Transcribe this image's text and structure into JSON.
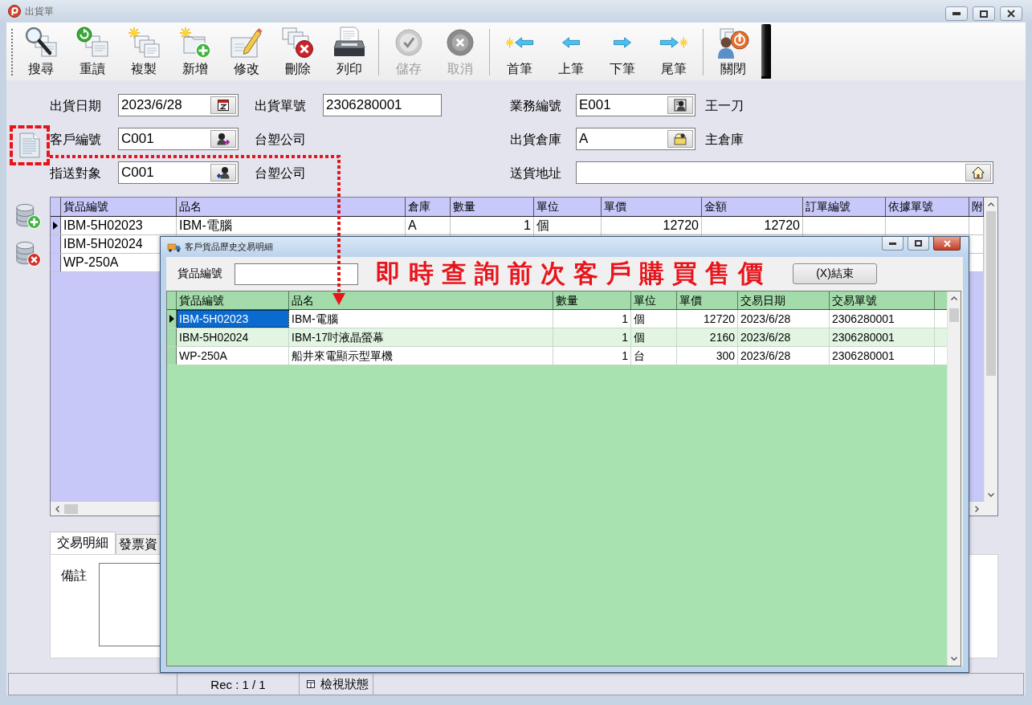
{
  "window": {
    "title": "出貨單"
  },
  "toolbar": [
    {
      "buttons": [
        {
          "label": "搜尋",
          "kind": "search",
          "disabled": false
        },
        {
          "label": "重讀",
          "kind": "reload",
          "disabled": false
        },
        {
          "label": "複製",
          "kind": "copy",
          "disabled": false
        },
        {
          "label": "新增",
          "kind": "add",
          "disabled": false
        },
        {
          "label": "修改",
          "kind": "edit",
          "disabled": false
        },
        {
          "label": "刪除",
          "kind": "delete",
          "disabled": false
        },
        {
          "label": "列印",
          "kind": "print",
          "disabled": false
        }
      ]
    },
    {
      "buttons": [
        {
          "label": "儲存",
          "kind": "save",
          "disabled": true
        },
        {
          "label": "取消",
          "kind": "cancel",
          "disabled": true
        }
      ]
    },
    {
      "buttons": [
        {
          "label": "首筆",
          "kind": "first",
          "disabled": false
        },
        {
          "label": "上筆",
          "kind": "prev",
          "disabled": false
        },
        {
          "label": "下筆",
          "kind": "next",
          "disabled": false
        },
        {
          "label": "尾筆",
          "kind": "last",
          "disabled": false
        }
      ]
    },
    {
      "buttons": [
        {
          "label": "關閉",
          "kind": "close",
          "disabled": false
        }
      ]
    }
  ],
  "form": {
    "left": [
      {
        "label": "出貨日期",
        "value": "2023/6/28",
        "kind": "date",
        "extra": {
          "label": "出貨單號",
          "value": "2306280001"
        }
      },
      {
        "label": "客戶編號",
        "value": "C001",
        "kind": "customer",
        "note": "台塑公司"
      },
      {
        "label": "指送對象",
        "value": "C001",
        "kind": "recipient",
        "note": "台塑公司"
      }
    ],
    "right": [
      {
        "label": "業務編號",
        "value": "E001",
        "kind": "staff",
        "note": "王一刀"
      },
      {
        "label": "出貨倉庫",
        "value": "A",
        "kind": "warehouse",
        "note": "主倉庫"
      },
      {
        "label": "送貨地址",
        "kind": "address"
      }
    ]
  },
  "detail_table": {
    "columns": [
      {
        "label": "貨品編號",
        "kind": "text"
      },
      {
        "label": "品名",
        "kind": "text"
      },
      {
        "label": "倉庫",
        "kind": "text"
      },
      {
        "label": "數量",
        "kind": "number"
      },
      {
        "label": "單位",
        "kind": "text"
      },
      {
        "label": "單價",
        "kind": "number"
      },
      {
        "label": "金額",
        "kind": "number"
      },
      {
        "label": "訂單編號",
        "kind": "text"
      },
      {
        "label": "依據單號",
        "kind": "text"
      },
      {
        "label": "附",
        "kind": "text"
      }
    ],
    "rows": [
      {
        "current": true,
        "cells": [
          "IBM-5H02023",
          "IBM-電腦",
          "A",
          "1",
          "個",
          "12720",
          "12720"
        ]
      },
      {
        "current": false,
        "cells": [
          "IBM-5H02024"
        ]
      },
      {
        "current": false,
        "cells": [
          "WP-250A"
        ]
      }
    ]
  },
  "tabs": [
    {
      "label": "交易明細",
      "selected": true
    },
    {
      "label": "發票資",
      "selected": false
    }
  ],
  "remark": {
    "label": "備註"
  },
  "status_bar": {
    "record": "Rec : 1 / 1",
    "mode": "檢視狀態"
  },
  "dialog": {
    "title": "客戶貨品歷史交易明細",
    "search_label": "貨品編號",
    "banner": "即時查詢前次客戶購買售價",
    "close_button": "(X)結束",
    "table": {
      "columns": [
        {
          "label": "貨品編號",
          "kind": "text"
        },
        {
          "label": "品名",
          "kind": "text"
        },
        {
          "label": "數量",
          "kind": "number"
        },
        {
          "label": "單位",
          "kind": "text"
        },
        {
          "label": "單價",
          "kind": "number"
        },
        {
          "label": "交易日期",
          "kind": "text"
        },
        {
          "label": "交易單號",
          "kind": "text"
        }
      ],
      "rows": [
        {
          "current": true,
          "cells": [
            "IBM-5H02023",
            "IBM-電腦",
            "1",
            "個",
            "12720",
            "2023/6/28",
            "2306280001"
          ]
        },
        {
          "current": false,
          "cells": [
            "IBM-5H02024",
            "IBM-17吋液晶螢幕",
            "1",
            "個",
            "2160",
            "2023/6/28",
            "2306280001"
          ]
        },
        {
          "current": false,
          "cells": [
            "WP-250A",
            "船井來電顯示型單機",
            "1",
            "台",
            "300",
            "2023/6/28",
            "2306280001"
          ]
        }
      ]
    }
  }
}
